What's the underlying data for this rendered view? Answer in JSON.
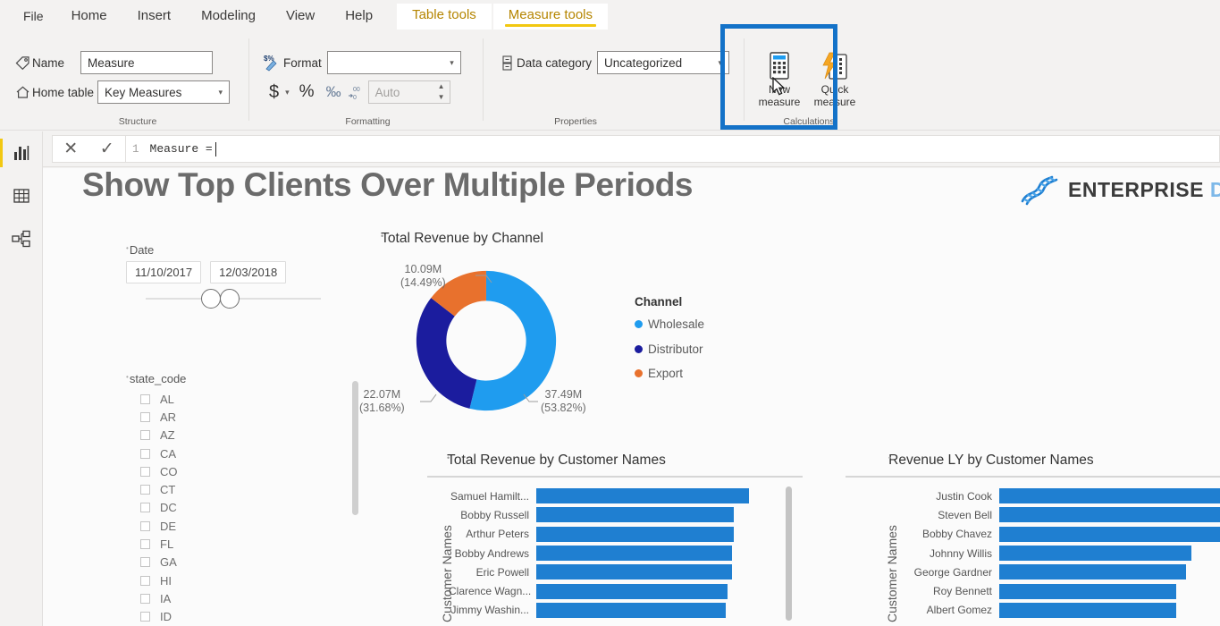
{
  "ribbon": {
    "tabs": [
      {
        "label": "File",
        "type": "file"
      },
      {
        "label": "Home",
        "type": "normal"
      },
      {
        "label": "Insert",
        "type": "normal"
      },
      {
        "label": "Modeling",
        "type": "normal"
      },
      {
        "label": "View",
        "type": "normal"
      },
      {
        "label": "Help",
        "type": "normal"
      },
      {
        "label": "Table tools",
        "type": "contextual"
      },
      {
        "label": "Measure tools",
        "type": "contextual-active"
      }
    ],
    "structure": {
      "group_label": "Structure",
      "name_label": "Name",
      "name_value": "Measure",
      "home_table_label": "Home table",
      "home_table_value": "Key Measures"
    },
    "formatting": {
      "group_label": "Formatting",
      "format_label": "Format",
      "format_value": "",
      "currency_label": "$",
      "percent_label": "%",
      "comma_label": "‰",
      "decimal_label": ".00",
      "decimal_places_value": "Auto"
    },
    "properties": {
      "group_label": "Properties",
      "data_category_label": "Data category",
      "data_category_value": "Uncategorized"
    },
    "calculations": {
      "group_label": "Calculations",
      "new_measure_line1": "New",
      "new_measure_line2": "measure",
      "quick_measure_line1": "Quick",
      "quick_measure_line2": "measure"
    },
    "highlight_color": "#1372c8"
  },
  "formula_bar": {
    "cancel_icon": "✕",
    "accept_icon": "✓",
    "line_number": "1",
    "text": "Measure ="
  },
  "rail": {
    "items": [
      {
        "name": "report-view",
        "active": true
      },
      {
        "name": "data-view",
        "active": false
      },
      {
        "name": "model-view",
        "active": false
      }
    ]
  },
  "report": {
    "title": "Show Top Clients Over Multiple Periods",
    "brand_text": "ENTERPRISE",
    "brand_text_cut": " D"
  },
  "date_slicer": {
    "label": "Date",
    "start": "11/10/2017",
    "end": "12/03/2018"
  },
  "state_slicer": {
    "label": "state_code",
    "items": [
      "AL",
      "AR",
      "AZ",
      "CA",
      "CO",
      "CT",
      "DC",
      "DE",
      "FL",
      "GA",
      "HI",
      "IA",
      "ID"
    ]
  },
  "chart_data": [
    {
      "type": "pie",
      "title": "Total Revenue by Channel",
      "legend_title": "Channel",
      "legend_position": "right",
      "labels": [
        "Wholesale",
        "Distributor",
        "Export"
      ],
      "values": [
        37.49,
        22.07,
        10.09
      ],
      "value_labels": [
        "37.49M",
        "22.07M",
        "10.09M"
      ],
      "percent_labels": [
        "(53.82%)",
        "(31.68%)",
        "(14.49%)"
      ],
      "percents": [
        53.82,
        31.68,
        14.49
      ],
      "colors": [
        "#1f9cef",
        "#1b1c9e",
        "#e8712d"
      ],
      "unit": "M"
    },
    {
      "type": "bar",
      "title": "Total Revenue by Customer Names",
      "xlabel": "",
      "ylabel": "Customer Names",
      "orientation": "horizontal",
      "bar_color": "#1f7fd1",
      "categories": [
        "Samuel Hamilt...",
        "Bobby Russell",
        "Arthur Peters",
        "Bobby Andrews",
        "Eric Powell",
        "Clarence Wagn...",
        "Jimmy Washin..."
      ],
      "values": [
        100,
        93,
        93,
        92,
        92,
        90,
        89
      ]
    },
    {
      "type": "bar",
      "title": "Revenue LY by Customer Names",
      "xlabel": "",
      "ylabel": "Customer Names",
      "orientation": "horizontal",
      "bar_color": "#1f7fd1",
      "categories": [
        "Justin Cook",
        "Steven Bell",
        "Bobby Chavez",
        "Johnny Willis",
        "George Gardner",
        "Roy Bennett",
        "Albert Gomez"
      ],
      "values": [
        100,
        93,
        93,
        76,
        74,
        70,
        70
      ]
    }
  ]
}
